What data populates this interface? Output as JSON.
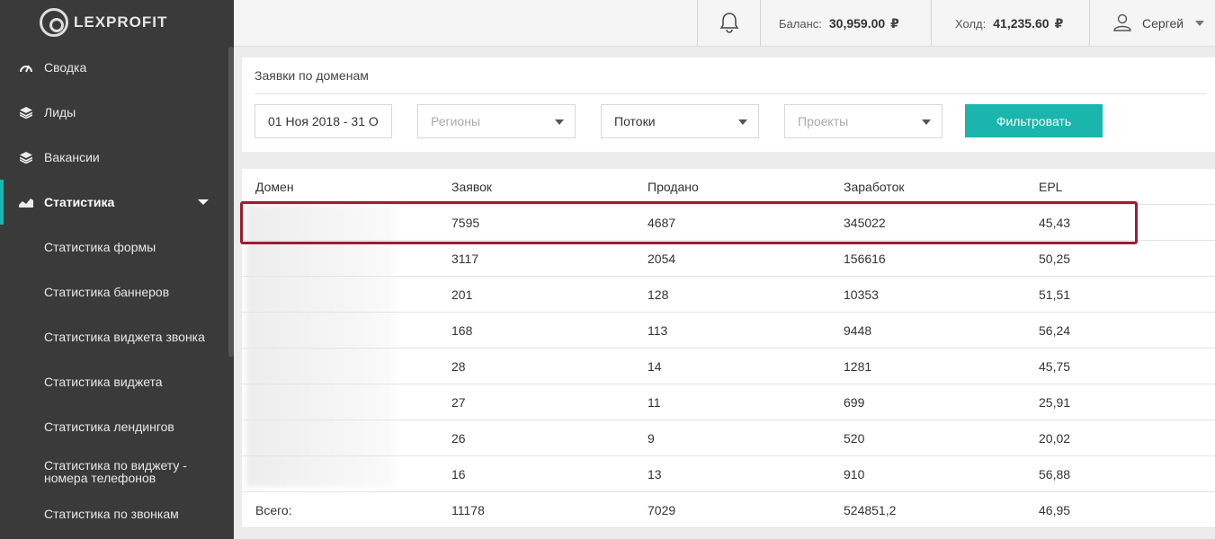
{
  "app": {
    "logo_text": "LEXPROFIT"
  },
  "sidebar": {
    "items": [
      {
        "label": "Сводка",
        "icon": "dashboard-icon"
      },
      {
        "label": "Лиды",
        "icon": "layers-icon"
      },
      {
        "label": "Вакансии",
        "icon": "layers-icon"
      },
      {
        "label": "Статистика",
        "icon": "chart-icon",
        "active": true
      }
    ],
    "subitems": [
      "Статистика формы",
      "Статистика баннеров",
      "Статистика виджета звонка",
      "Статистика виджета",
      "Статистика лендингов",
      "Статистика по виджету - номера телефонов",
      "Статистика по звонкам"
    ]
  },
  "topbar": {
    "balance_label": "Баланс:",
    "balance_value": "30,959.00",
    "hold_label": "Холд:",
    "hold_value": "41,235.60",
    "currency": "₽",
    "user_name": "Сергей"
  },
  "filters": {
    "title": "Заявки по доменам",
    "date_range": "01 Ноя 2018 - 31 О",
    "regions_placeholder": "Регионы",
    "streams_value": "Потоки",
    "projects_placeholder": "Проекты",
    "filter_button": "Фильтровать"
  },
  "table": {
    "headers": [
      "Домен",
      "Заявок",
      "Продано",
      "Заработок",
      "EPL"
    ],
    "rows": [
      [
        "",
        "7595",
        "4687",
        "345022",
        "45,43"
      ],
      [
        "",
        "3117",
        "2054",
        "156616",
        "50,25"
      ],
      [
        "",
        "201",
        "128",
        "10353",
        "51,51"
      ],
      [
        "",
        "168",
        "113",
        "9448",
        "56,24"
      ],
      [
        "",
        "28",
        "14",
        "1281",
        "45,75"
      ],
      [
        "",
        "27",
        "11",
        "699",
        "25,91"
      ],
      [
        "",
        "26",
        "9",
        "520",
        "20,02"
      ],
      [
        "",
        "16",
        "13",
        "910",
        "56,88"
      ]
    ],
    "total": [
      "Всего:",
      "11178",
      "7029",
      "524851,2",
      "46,95"
    ]
  },
  "colors": {
    "accent": "#1ab5ac",
    "sidebar": "#3a3a3a",
    "highlight": "#a01c2e"
  }
}
